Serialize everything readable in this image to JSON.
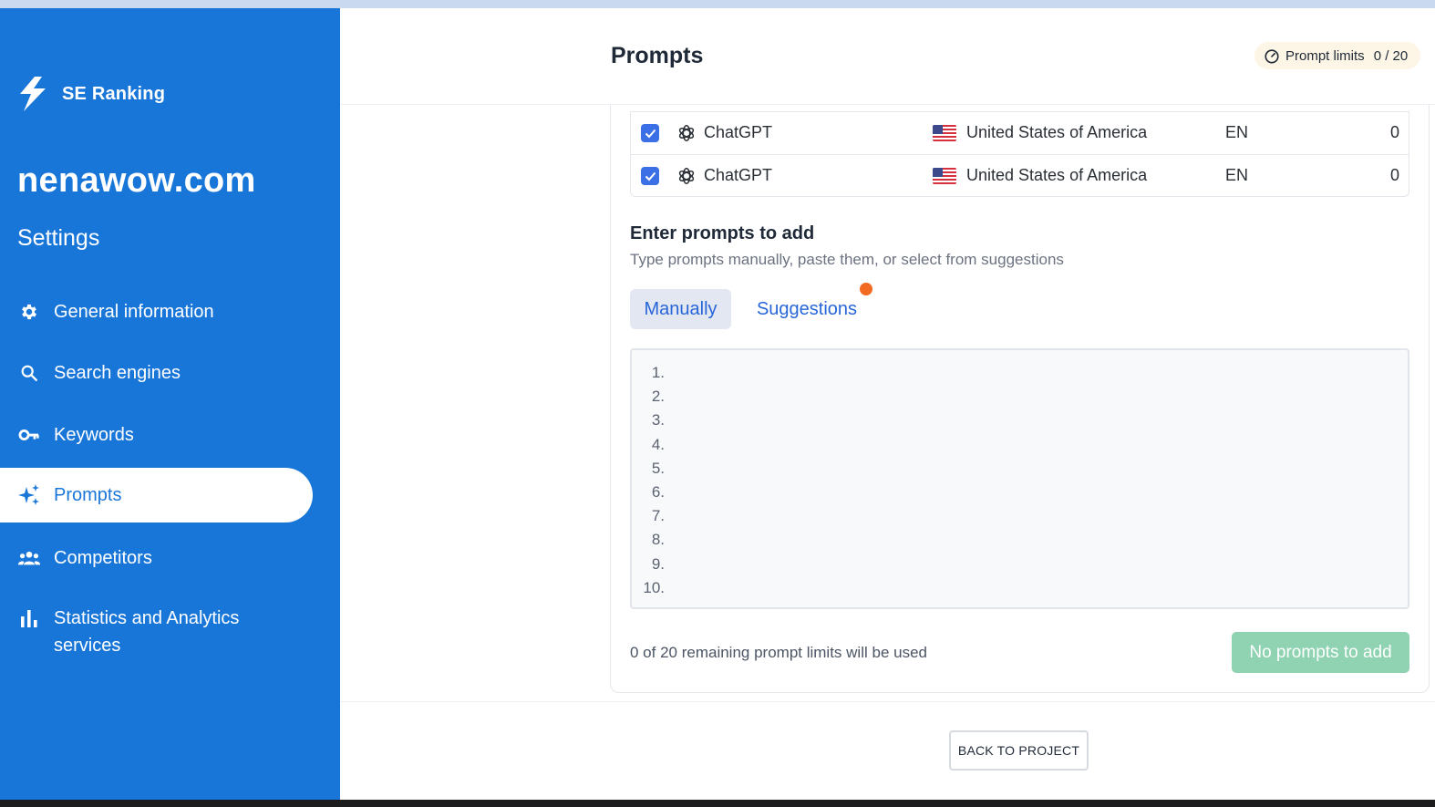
{
  "sidebar": {
    "brand_name": "SE Ranking",
    "project_name": "nenawow.com",
    "settings_title": "Settings",
    "items": [
      {
        "label": "General information",
        "icon": "gear-icon"
      },
      {
        "label": "Search engines",
        "icon": "search-icon"
      },
      {
        "label": "Keywords",
        "icon": "key-icon"
      },
      {
        "label": "Prompts",
        "icon": "sparkle-icon",
        "active": true
      },
      {
        "label": "Competitors",
        "icon": "people-icon"
      },
      {
        "label": "Statistics and Analytics services",
        "icon": "bar-chart-icon"
      }
    ]
  },
  "header": {
    "title": "Prompts",
    "limits_label": "Prompt limits",
    "limits_count": "0 / 20"
  },
  "engines_table": {
    "rows": [
      {
        "checked": true,
        "engine": "ChatGPT",
        "country": "United States of America",
        "lang": "EN",
        "count": "0"
      },
      {
        "checked": true,
        "engine": "ChatGPT",
        "country": "United States of America",
        "lang": "EN",
        "count": "0"
      }
    ]
  },
  "prompts_section": {
    "title": "Enter prompts to add",
    "subtitle": "Type prompts manually, paste them, or select from suggestions",
    "tabs": [
      {
        "label": "Manually",
        "active": true
      },
      {
        "label": "Suggestions",
        "active": false,
        "has_dot": true
      }
    ],
    "line_numbers": [
      "1.",
      "2.",
      "3.",
      "4.",
      "5.",
      "6.",
      "7.",
      "8.",
      "9.",
      "10."
    ],
    "editor_value": "",
    "usage_text": "0 of 20 remaining prompt limits will be used",
    "add_button_label": "No prompts to add"
  },
  "footer": {
    "back_button_label": "BACK TO PROJECT"
  },
  "colors": {
    "sidebar_bg": "#1976d9",
    "accent": "#2766d8",
    "add_button_disabled": "#8fd3b2",
    "notification_dot": "#f26a21"
  }
}
